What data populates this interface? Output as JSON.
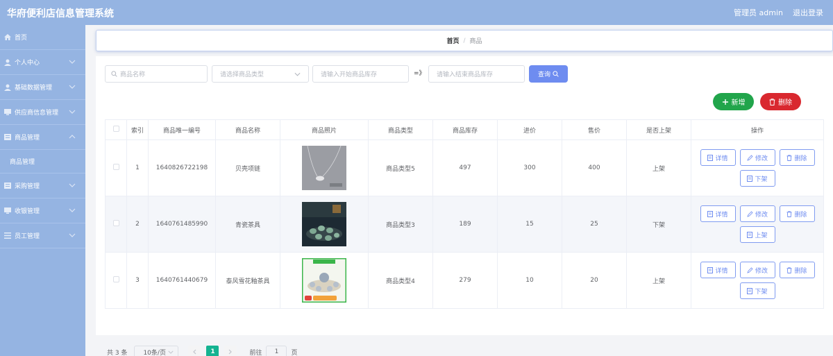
{
  "header": {
    "title": "华府便利店信息管理系统",
    "user": "管理员 admin",
    "logout": "退出登录"
  },
  "sidebar": {
    "items": [
      {
        "label": "首页",
        "icon": "home-icon"
      },
      {
        "label": "个人中心",
        "icon": "user-icon"
      },
      {
        "label": "基础数据管理",
        "icon": "user-icon"
      },
      {
        "label": "供应商信息管理",
        "icon": "monitor-icon"
      },
      {
        "label": "商品管理",
        "icon": "grid-icon"
      },
      {
        "label": "采购管理",
        "icon": "grid-icon"
      },
      {
        "label": "收银管理",
        "icon": "monitor-icon"
      },
      {
        "label": "员工管理",
        "icon": "list-icon"
      }
    ],
    "sub_item": "商品管理"
  },
  "breadcrumb": {
    "home": "首页",
    "separator": "/",
    "current": "商品"
  },
  "search": {
    "name_placeholder": "商品名称",
    "type_placeholder": "请选择商品类型",
    "stock_start_placeholder": "请输入开始商品库存",
    "range_separator": "=》",
    "stock_end_placeholder": "请输入结束商品库存",
    "button": "查询"
  },
  "actions": {
    "add": "新增",
    "delete": "删除"
  },
  "table": {
    "headers": [
      "索引",
      "商品唯一编号",
      "商品名称",
      "商品照片",
      "商品类型",
      "商品库存",
      "进价",
      "售价",
      "是否上架",
      "操作"
    ],
    "rows": [
      {
        "index": "1",
        "code": "1640826722198",
        "name": "贝壳项链",
        "type": "商品类型5",
        "stock": "497",
        "cost": "300",
        "price": "400",
        "on_shelf": "上架",
        "toggle": "下架"
      },
      {
        "index": "2",
        "code": "1640761485990",
        "name": "青瓷茶具",
        "type": "商品类型3",
        "stock": "189",
        "cost": "15",
        "price": "25",
        "on_shelf": "下架",
        "toggle": "上架"
      },
      {
        "index": "3",
        "code": "1640761440679",
        "name": "泰风雪花釉茶具",
        "type": "商品类型4",
        "stock": "279",
        "cost": "10",
        "price": "20",
        "on_shelf": "上架",
        "toggle": "下架"
      }
    ],
    "op_labels": {
      "detail": "详情",
      "edit": "修改",
      "delete": "删除"
    }
  },
  "pagination": {
    "total": "共 3 条",
    "page_size": "10条/页",
    "current_page": "1",
    "goto_prefix": "前往",
    "goto_value": "1",
    "goto_suffix": "页"
  },
  "colors": {
    "brand": "#95b4e2",
    "primary": "#6e8cf0",
    "success": "#21a54b",
    "danger": "#d9282f",
    "page_active": "#14b391"
  }
}
